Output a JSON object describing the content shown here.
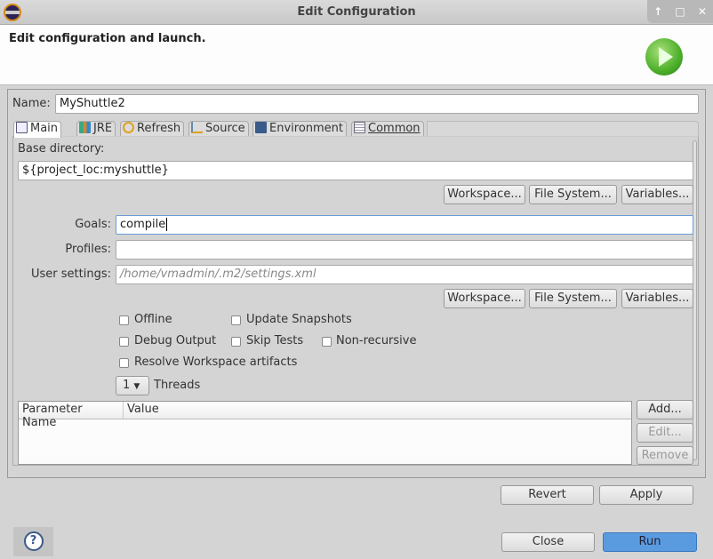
{
  "window": {
    "title": "Edit Configuration",
    "buttons": [
      "↑",
      "□",
      "✕"
    ]
  },
  "header": {
    "title": "Edit configuration and launch."
  },
  "name": {
    "label": "Name:",
    "value": "MyShuttle2"
  },
  "tabs": [
    {
      "label": "Main",
      "icon": "document-icon"
    },
    {
      "label": "JRE",
      "icon": "library-icon"
    },
    {
      "label": "Refresh",
      "icon": "refresh-icon"
    },
    {
      "label": "Source",
      "icon": "source-icon"
    },
    {
      "label": "Environment",
      "icon": "environment-icon"
    },
    {
      "label": "Common",
      "icon": "common-icon"
    }
  ],
  "main": {
    "base_dir_label": "Base directory:",
    "base_dir_value": "${project_loc:myshuttle}",
    "workspace": "Workspace...",
    "filesystem": "File System...",
    "variables": "Variables...",
    "goals_label": "Goals:",
    "goals_value": "compile",
    "profiles_label": "Profiles:",
    "profiles_value": "",
    "settings_label": "User settings:",
    "settings_placeholder": "/home/vmadmin/.m2/settings.xml",
    "checkboxes": [
      {
        "label": "Offline",
        "checked": false
      },
      {
        "label": "Update Snapshots",
        "checked": false
      },
      {
        "label": "Debug Output",
        "checked": false
      },
      {
        "label": "Skip Tests",
        "checked": false
      },
      {
        "label": "Non-recursive",
        "checked": false
      },
      {
        "label": "Resolve Workspace artifacts",
        "checked": false
      }
    ],
    "threads_value": "1",
    "threads_label": "Threads",
    "table": {
      "columns": [
        "Parameter Name",
        "Value"
      ],
      "rows": []
    },
    "add": "Add...",
    "edit": "Edit...",
    "remove": "Remove"
  },
  "revert": "Revert",
  "apply": "Apply",
  "close": "Close",
  "run": "Run",
  "help": "?",
  "colors": {
    "run_button": "#5a9be0",
    "run_icon": "#4caf2a"
  }
}
